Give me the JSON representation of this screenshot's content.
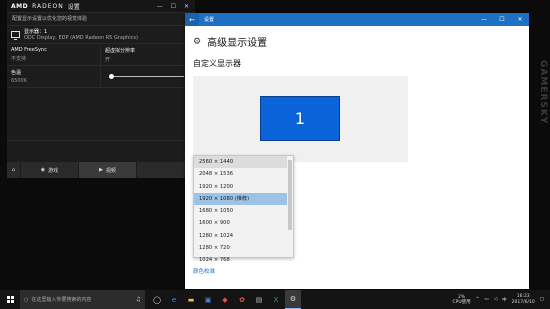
{
  "amd": {
    "brand": "AMD",
    "product": "RADEON",
    "section": "设置",
    "subtitle": "配置显示设置以优化您的视觉体验",
    "display_name": "显示器：1",
    "display_desc": "ODC Display, EDP (AMD Radeon R5 Graphics)",
    "freesync_label": "AMD FreeSync",
    "freesync_value": "不支持",
    "vsr_label": "超虚拟分辨率",
    "vsr_value": "开",
    "temp_label": "色温",
    "temp_value": "6500K",
    "nav": [
      {
        "label": "游戏",
        "icon": "gamepad-icon"
      },
      {
        "label": "视频",
        "icon": "play-icon"
      },
      {
        "label": "",
        "icon": "none"
      }
    ]
  },
  "settings": {
    "window_title": "设置",
    "page_title": "高级显示设置",
    "section_title": "自定义显示器",
    "monitor_number": "1",
    "resolutions": [
      "2560 × 1440",
      "2048 × 1536",
      "1920 × 1200",
      "1920 × 1080 (推荐)",
      "1680 × 1050",
      "1600 × 900",
      "1280 × 1024",
      "1280 × 720",
      "1024 × 768"
    ],
    "selected_index": 3,
    "link": "颜色校准"
  },
  "taskbar": {
    "search_placeholder": "在这里输入你要搜索的内容",
    "cpu_percent": "2%",
    "cpu_label": "CPU使用",
    "time": "16:23",
    "date": "2017/6/10"
  },
  "watermark": "GAMERSKY",
  "colors": {
    "accent": "#1f6fc2",
    "monitor": "#0a63d8",
    "selected": "#9cc3e6"
  }
}
